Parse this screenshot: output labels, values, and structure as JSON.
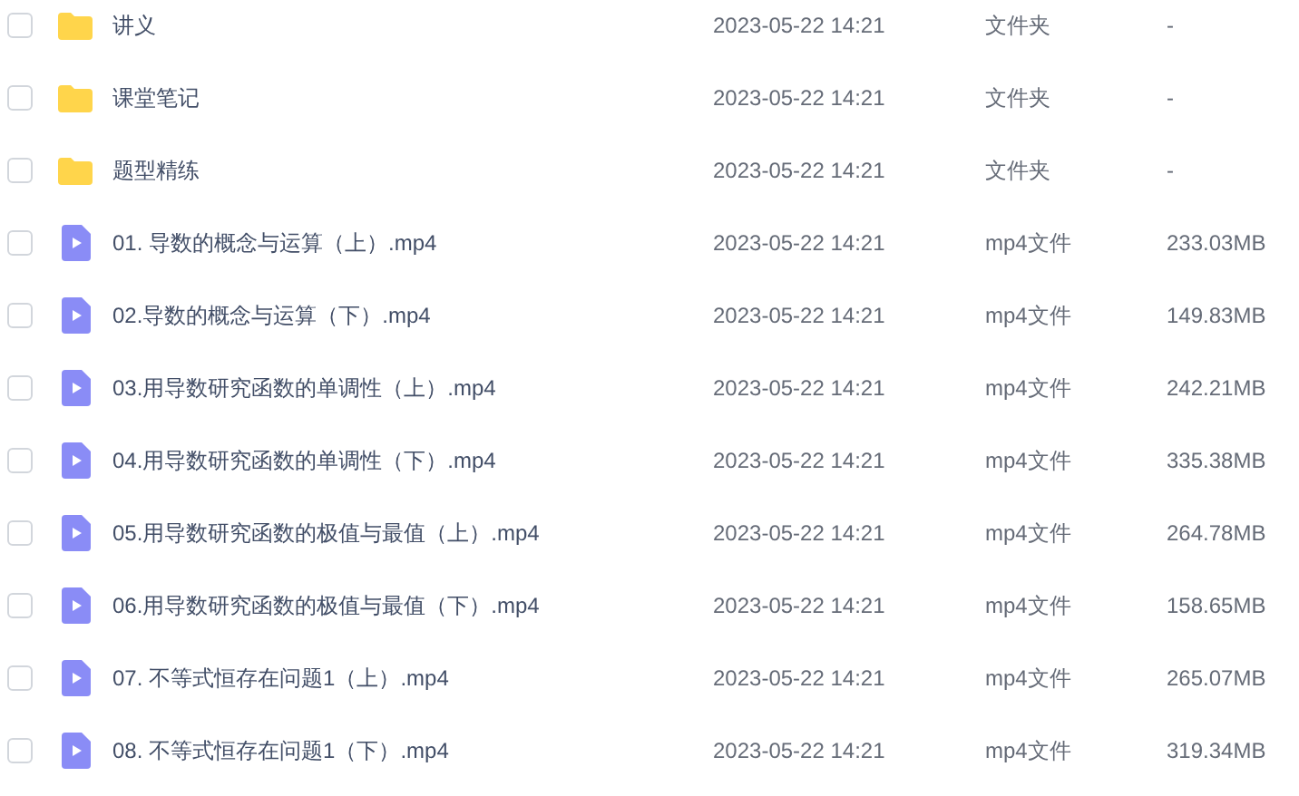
{
  "files": [
    {
      "kind": "folder",
      "checked": false,
      "name": "讲义",
      "modified": "2023-05-22 14:21",
      "type": "文件夹",
      "size": "-"
    },
    {
      "kind": "folder",
      "checked": false,
      "name": "课堂笔记",
      "modified": "2023-05-22 14:21",
      "type": "文件夹",
      "size": "-"
    },
    {
      "kind": "folder",
      "checked": false,
      "name": "题型精练",
      "modified": "2023-05-22 14:21",
      "type": "文件夹",
      "size": "-"
    },
    {
      "kind": "video",
      "checked": false,
      "name": "01. 导数的概念与运算（上）.mp4",
      "modified": "2023-05-22 14:21",
      "type": "mp4文件",
      "size": "233.03MB"
    },
    {
      "kind": "video",
      "checked": false,
      "name": "02.导数的概念与运算（下）.mp4",
      "modified": "2023-05-22 14:21",
      "type": "mp4文件",
      "size": "149.83MB"
    },
    {
      "kind": "video",
      "checked": false,
      "name": "03.用导数研究函数的单调性（上）.mp4",
      "modified": "2023-05-22 14:21",
      "type": "mp4文件",
      "size": "242.21MB"
    },
    {
      "kind": "video",
      "checked": false,
      "name": "04.用导数研究函数的单调性（下）.mp4",
      "modified": "2023-05-22 14:21",
      "type": "mp4文件",
      "size": "335.38MB"
    },
    {
      "kind": "video",
      "checked": false,
      "name": "05.用导数研究函数的极值与最值（上）.mp4",
      "modified": "2023-05-22 14:21",
      "type": "mp4文件",
      "size": "264.78MB"
    },
    {
      "kind": "video",
      "checked": false,
      "name": "06.用导数研究函数的极值与最值（下）.mp4",
      "modified": "2023-05-22 14:21",
      "type": "mp4文件",
      "size": "158.65MB"
    },
    {
      "kind": "video",
      "checked": false,
      "name": "07. 不等式恒存在问题1（上）.mp4",
      "modified": "2023-05-22 14:21",
      "type": "mp4文件",
      "size": "265.07MB"
    },
    {
      "kind": "video",
      "checked": false,
      "name": "08. 不等式恒存在问题1（下）.mp4",
      "modified": "2023-05-22 14:21",
      "type": "mp4文件",
      "size": "319.34MB"
    }
  ]
}
